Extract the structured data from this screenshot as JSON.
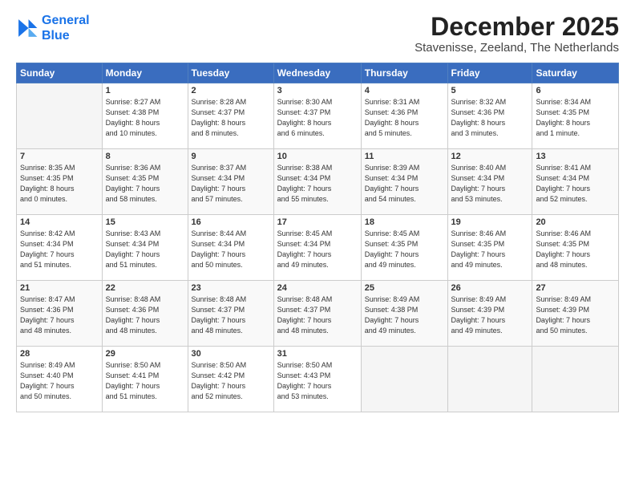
{
  "logo": {
    "line1": "General",
    "line2": "Blue"
  },
  "header": {
    "month": "December 2025",
    "location": "Stavenisse, Zeeland, The Netherlands"
  },
  "weekdays": [
    "Sunday",
    "Monday",
    "Tuesday",
    "Wednesday",
    "Thursday",
    "Friday",
    "Saturday"
  ],
  "weeks": [
    [
      {
        "day": "",
        "info": ""
      },
      {
        "day": "1",
        "info": "Sunrise: 8:27 AM\nSunset: 4:38 PM\nDaylight: 8 hours\nand 10 minutes."
      },
      {
        "day": "2",
        "info": "Sunrise: 8:28 AM\nSunset: 4:37 PM\nDaylight: 8 hours\nand 8 minutes."
      },
      {
        "day": "3",
        "info": "Sunrise: 8:30 AM\nSunset: 4:37 PM\nDaylight: 8 hours\nand 6 minutes."
      },
      {
        "day": "4",
        "info": "Sunrise: 8:31 AM\nSunset: 4:36 PM\nDaylight: 8 hours\nand 5 minutes."
      },
      {
        "day": "5",
        "info": "Sunrise: 8:32 AM\nSunset: 4:36 PM\nDaylight: 8 hours\nand 3 minutes."
      },
      {
        "day": "6",
        "info": "Sunrise: 8:34 AM\nSunset: 4:35 PM\nDaylight: 8 hours\nand 1 minute."
      }
    ],
    [
      {
        "day": "7",
        "info": "Sunrise: 8:35 AM\nSunset: 4:35 PM\nDaylight: 8 hours\nand 0 minutes."
      },
      {
        "day": "8",
        "info": "Sunrise: 8:36 AM\nSunset: 4:35 PM\nDaylight: 7 hours\nand 58 minutes."
      },
      {
        "day": "9",
        "info": "Sunrise: 8:37 AM\nSunset: 4:34 PM\nDaylight: 7 hours\nand 57 minutes."
      },
      {
        "day": "10",
        "info": "Sunrise: 8:38 AM\nSunset: 4:34 PM\nDaylight: 7 hours\nand 55 minutes."
      },
      {
        "day": "11",
        "info": "Sunrise: 8:39 AM\nSunset: 4:34 PM\nDaylight: 7 hours\nand 54 minutes."
      },
      {
        "day": "12",
        "info": "Sunrise: 8:40 AM\nSunset: 4:34 PM\nDaylight: 7 hours\nand 53 minutes."
      },
      {
        "day": "13",
        "info": "Sunrise: 8:41 AM\nSunset: 4:34 PM\nDaylight: 7 hours\nand 52 minutes."
      }
    ],
    [
      {
        "day": "14",
        "info": "Sunrise: 8:42 AM\nSunset: 4:34 PM\nDaylight: 7 hours\nand 51 minutes."
      },
      {
        "day": "15",
        "info": "Sunrise: 8:43 AM\nSunset: 4:34 PM\nDaylight: 7 hours\nand 51 minutes."
      },
      {
        "day": "16",
        "info": "Sunrise: 8:44 AM\nSunset: 4:34 PM\nDaylight: 7 hours\nand 50 minutes."
      },
      {
        "day": "17",
        "info": "Sunrise: 8:45 AM\nSunset: 4:34 PM\nDaylight: 7 hours\nand 49 minutes."
      },
      {
        "day": "18",
        "info": "Sunrise: 8:45 AM\nSunset: 4:35 PM\nDaylight: 7 hours\nand 49 minutes."
      },
      {
        "day": "19",
        "info": "Sunrise: 8:46 AM\nSunset: 4:35 PM\nDaylight: 7 hours\nand 49 minutes."
      },
      {
        "day": "20",
        "info": "Sunrise: 8:46 AM\nSunset: 4:35 PM\nDaylight: 7 hours\nand 48 minutes."
      }
    ],
    [
      {
        "day": "21",
        "info": "Sunrise: 8:47 AM\nSunset: 4:36 PM\nDaylight: 7 hours\nand 48 minutes."
      },
      {
        "day": "22",
        "info": "Sunrise: 8:48 AM\nSunset: 4:36 PM\nDaylight: 7 hours\nand 48 minutes."
      },
      {
        "day": "23",
        "info": "Sunrise: 8:48 AM\nSunset: 4:37 PM\nDaylight: 7 hours\nand 48 minutes."
      },
      {
        "day": "24",
        "info": "Sunrise: 8:48 AM\nSunset: 4:37 PM\nDaylight: 7 hours\nand 48 minutes."
      },
      {
        "day": "25",
        "info": "Sunrise: 8:49 AM\nSunset: 4:38 PM\nDaylight: 7 hours\nand 49 minutes."
      },
      {
        "day": "26",
        "info": "Sunrise: 8:49 AM\nSunset: 4:39 PM\nDaylight: 7 hours\nand 49 minutes."
      },
      {
        "day": "27",
        "info": "Sunrise: 8:49 AM\nSunset: 4:39 PM\nDaylight: 7 hours\nand 50 minutes."
      }
    ],
    [
      {
        "day": "28",
        "info": "Sunrise: 8:49 AM\nSunset: 4:40 PM\nDaylight: 7 hours\nand 50 minutes."
      },
      {
        "day": "29",
        "info": "Sunrise: 8:50 AM\nSunset: 4:41 PM\nDaylight: 7 hours\nand 51 minutes."
      },
      {
        "day": "30",
        "info": "Sunrise: 8:50 AM\nSunset: 4:42 PM\nDaylight: 7 hours\nand 52 minutes."
      },
      {
        "day": "31",
        "info": "Sunrise: 8:50 AM\nSunset: 4:43 PM\nDaylight: 7 hours\nand 53 minutes."
      },
      {
        "day": "",
        "info": ""
      },
      {
        "day": "",
        "info": ""
      },
      {
        "day": "",
        "info": ""
      }
    ]
  ]
}
